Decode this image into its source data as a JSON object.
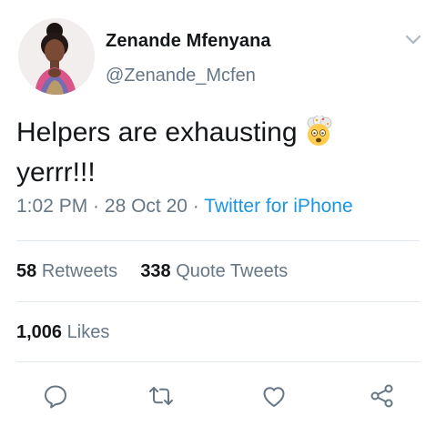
{
  "user": {
    "display_name": "Zenande Mfenyana",
    "handle": "@Zenande_Mcfen",
    "avatar_icon": "profile-photo"
  },
  "tweet": {
    "text_line1": "Helpers are exhausting",
    "text_line2": "yerrr!!!",
    "emoji": "exploding-head-emoji"
  },
  "meta": {
    "time": "1:02 PM",
    "separator": " · ",
    "date": "28 Oct 20",
    "source": "Twitter for iPhone"
  },
  "stats": {
    "retweets_count": "58",
    "retweets_label": "Retweets",
    "quote_count": "338",
    "quote_label": "Quote Tweets",
    "likes_count": "1,006",
    "likes_label": "Likes"
  },
  "actions": {
    "reply_icon": "reply-icon",
    "retweet_icon": "retweet-icon",
    "like_icon": "heart-icon",
    "share_icon": "share-icon"
  },
  "colors": {
    "text": "#14171a",
    "secondary": "#657786",
    "link": "#1b95e0",
    "divider": "#e1e8ed"
  }
}
